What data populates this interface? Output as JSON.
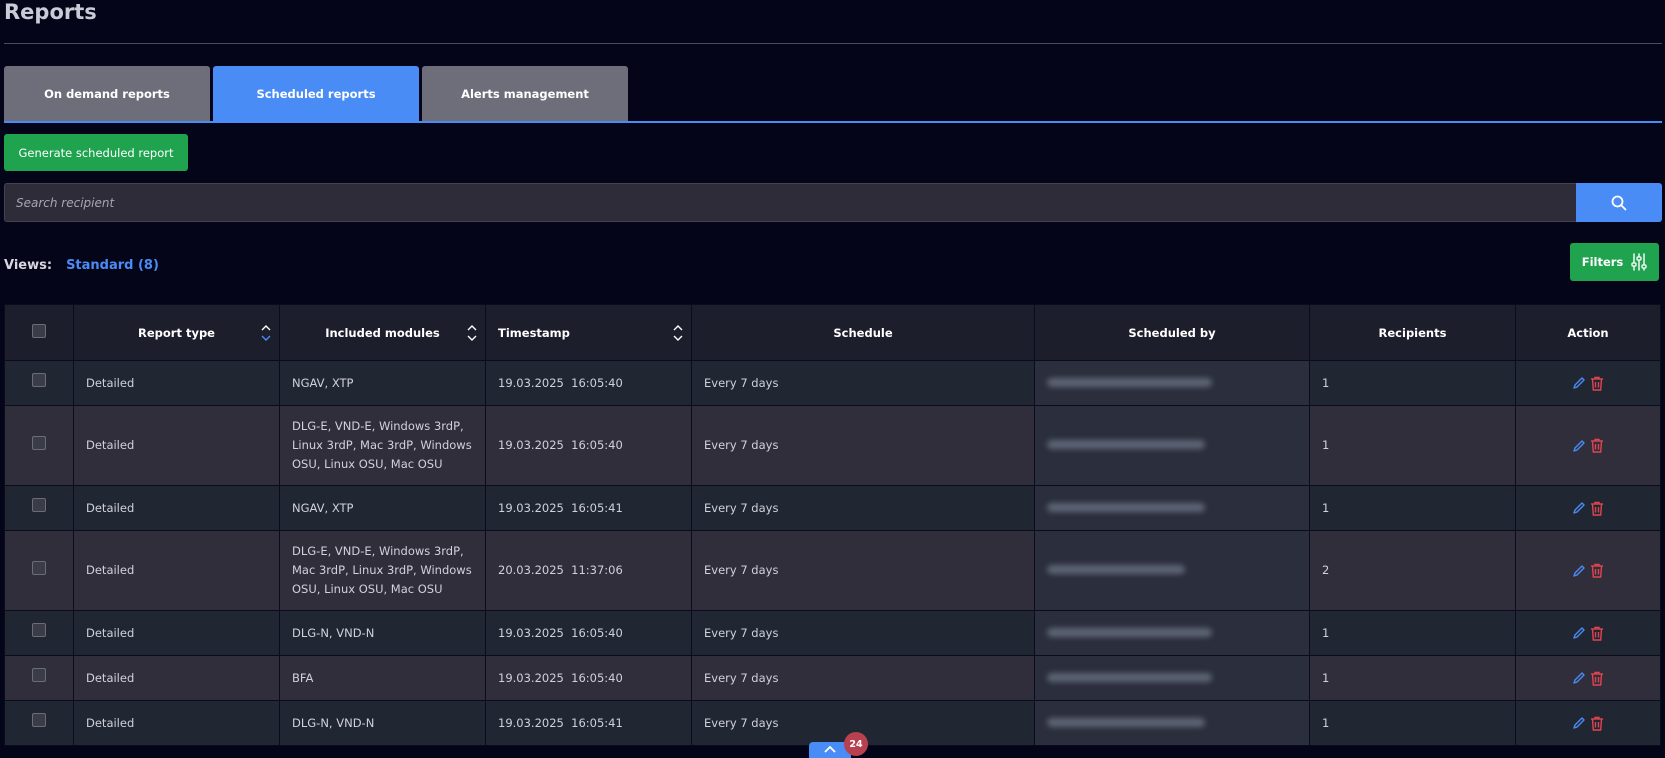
{
  "page": {
    "title": "Reports"
  },
  "tabs": [
    {
      "label": "On demand reports",
      "active": false
    },
    {
      "label": "Scheduled reports",
      "active": true
    },
    {
      "label": "Alerts management",
      "active": false
    }
  ],
  "actions": {
    "generate_label": "Generate scheduled report"
  },
  "search": {
    "placeholder": "Search recipient"
  },
  "views": {
    "label": "Views:",
    "value": "Standard (8)"
  },
  "filters": {
    "label": "Filters"
  },
  "table": {
    "columns": [
      "Report type",
      "Included modules",
      "Timestamp",
      "Schedule",
      "Scheduled by",
      "Recipients",
      "Action"
    ],
    "rows": [
      {
        "report_type": "Detailed",
        "modules": "NGAV, XTP",
        "timestamp": "19.03.2025  16:05:40",
        "schedule": "Every 7 days",
        "recipients": "1"
      },
      {
        "report_type": "Detailed",
        "modules": "DLG-E, VND-E, Windows 3rdP, Linux 3rdP, Mac 3rdP, Windows OSU, Linux OSU, Mac OSU",
        "timestamp": "19.03.2025  16:05:40",
        "schedule": "Every 7 days",
        "recipients": "1"
      },
      {
        "report_type": "Detailed",
        "modules": "NGAV, XTP",
        "timestamp": "19.03.2025  16:05:41",
        "schedule": "Every 7 days",
        "recipients": "1"
      },
      {
        "report_type": "Detailed",
        "modules": "DLG-E, VND-E, Windows 3rdP, Mac 3rdP, Linux 3rdP, Windows OSU, Linux OSU, Mac OSU",
        "timestamp": "20.03.2025  11:37:06",
        "schedule": "Every 7 days",
        "recipients": "2"
      },
      {
        "report_type": "Detailed",
        "modules": "DLG-N, VND-N",
        "timestamp": "19.03.2025  16:05:40",
        "schedule": "Every 7 days",
        "recipients": "1"
      },
      {
        "report_type": "Detailed",
        "modules": "BFA",
        "timestamp": "19.03.2025  16:05:40",
        "schedule": "Every 7 days",
        "recipients": "1"
      },
      {
        "report_type": "Detailed",
        "modules": "DLG-N, VND-N",
        "timestamp": "19.03.2025  16:05:41",
        "schedule": "Every 7 days",
        "recipients": "1"
      }
    ]
  },
  "footer": {
    "badge_count": "24"
  },
  "colors": {
    "accent": "#4a8cf5",
    "success": "#1fa34f",
    "danger": "#e0454f",
    "background": "#05051a"
  }
}
